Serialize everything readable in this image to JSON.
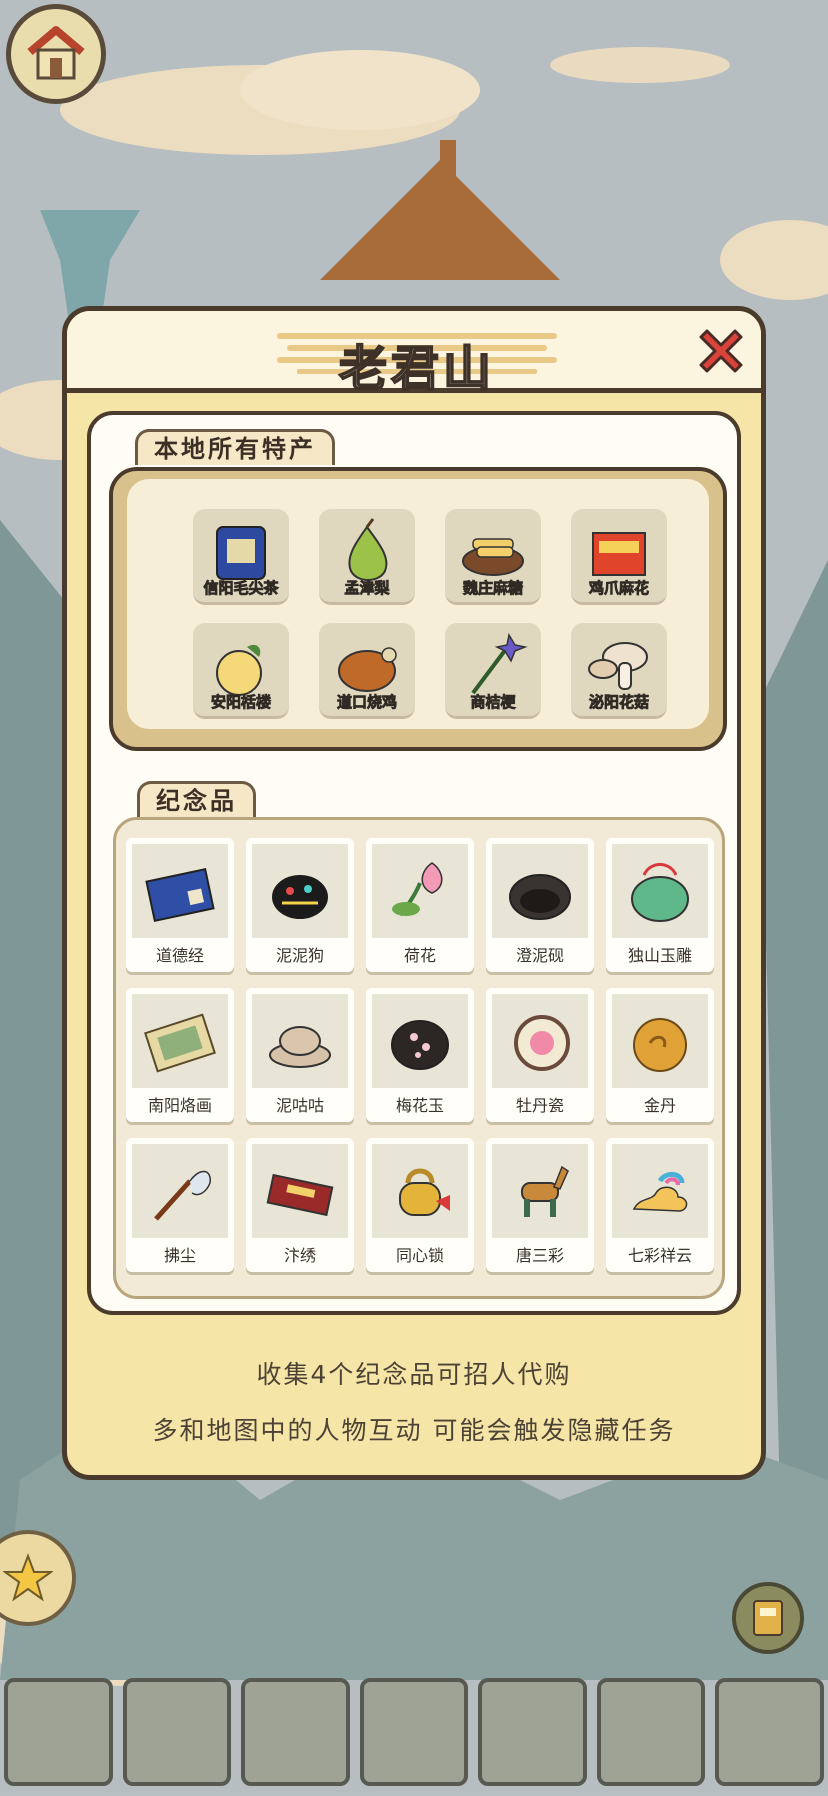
{
  "panel": {
    "title": "老君山",
    "specialty_tab": "本地所有特产",
    "souvenir_tab": "纪念品",
    "specialties": [
      {
        "label": "信阳毛尖茶",
        "icon": "tea-pack-icon"
      },
      {
        "label": "孟津梨",
        "icon": "pear-icon"
      },
      {
        "label": "魏庄麻糖",
        "icon": "sugar-sticks-icon"
      },
      {
        "label": "鸡爪麻花",
        "icon": "snack-box-icon"
      },
      {
        "label": "安阳栝楼",
        "icon": "melon-icon"
      },
      {
        "label": "道口烧鸡",
        "icon": "roast-chicken-icon"
      },
      {
        "label": "商桔梗",
        "icon": "balloon-flower-icon"
      },
      {
        "label": "泌阳花菇",
        "icon": "mushroom-icon"
      }
    ],
    "souvenirs": [
      {
        "label": "道德经",
        "icon": "book-icon"
      },
      {
        "label": "泥泥狗",
        "icon": "clay-dog-icon"
      },
      {
        "label": "荷花",
        "icon": "lotus-icon"
      },
      {
        "label": "澄泥砚",
        "icon": "inkstone-icon"
      },
      {
        "label": "独山玉雕",
        "icon": "jade-carving-icon"
      },
      {
        "label": "南阳烙画",
        "icon": "scroll-painting-icon"
      },
      {
        "label": "泥咕咕",
        "icon": "clay-whistle-icon"
      },
      {
        "label": "梅花玉",
        "icon": "plum-jade-icon"
      },
      {
        "label": "牡丹瓷",
        "icon": "peony-porcelain-icon"
      },
      {
        "label": "金丹",
        "icon": "golden-pill-icon"
      },
      {
        "label": "拂尘",
        "icon": "whisk-icon"
      },
      {
        "label": "汴绣",
        "icon": "embroidery-box-icon"
      },
      {
        "label": "同心锁",
        "icon": "lock-icon"
      },
      {
        "label": "唐三彩",
        "icon": "tang-horse-icon"
      },
      {
        "label": "七彩祥云",
        "icon": "rainbow-cloud-icon"
      }
    ],
    "hint_line1": "收集4个纪念品可招人代购",
    "hint_line2": "多和地图中的人物互动 可能会触发隐藏任务"
  },
  "colors": {
    "panel_bg": "#f5e5a6",
    "border": "#4a3b2c",
    "close_red": "#d8433a",
    "inner_bg": "#fffdf6"
  }
}
